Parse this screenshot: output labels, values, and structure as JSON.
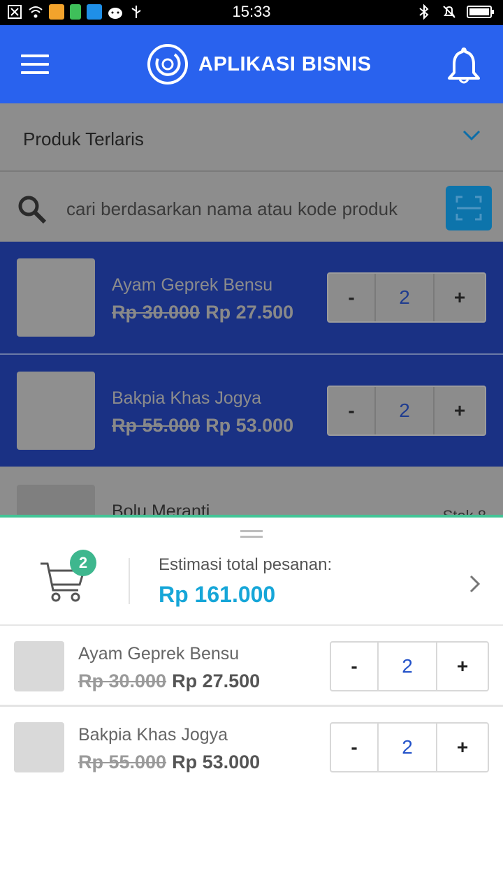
{
  "status_bar": {
    "time": "15:33"
  },
  "app_bar": {
    "title": "APLIKASI BISNIS"
  },
  "category": {
    "selected": "Produk Terlaris"
  },
  "search": {
    "placeholder": "cari berdasarkan nama atau kode produk"
  },
  "products": [
    {
      "name": "Ayam Geprek Bensu",
      "old_price": "Rp 30.000",
      "price": "Rp 27.500",
      "qty": "2",
      "selected": true
    },
    {
      "name": "Bakpia Khas Jogya",
      "old_price": "Rp 55.000",
      "price": "Rp 53.000",
      "qty": "2",
      "selected": true
    },
    {
      "name": "Bolu Meranti",
      "stock": "Stok 8",
      "selected": false
    }
  ],
  "stepper": {
    "minus": "-",
    "plus": "+"
  },
  "cart": {
    "count": "2",
    "estimate_label": "Estimasi total pesanan:",
    "estimate_total": "Rp 161.000",
    "items": [
      {
        "name": "Ayam Geprek Bensu",
        "old_price": "Rp 30.000",
        "price": "Rp 27.500",
        "qty": "2"
      },
      {
        "name": "Bakpia Khas Jogya",
        "old_price": "Rp 55.000",
        "price": "Rp 53.000",
        "qty": "2"
      }
    ]
  },
  "colors": {
    "primary": "#2962ee",
    "selected_row": "#1a3184",
    "accent": "#16a6d8",
    "badge": "#3eb78e"
  }
}
